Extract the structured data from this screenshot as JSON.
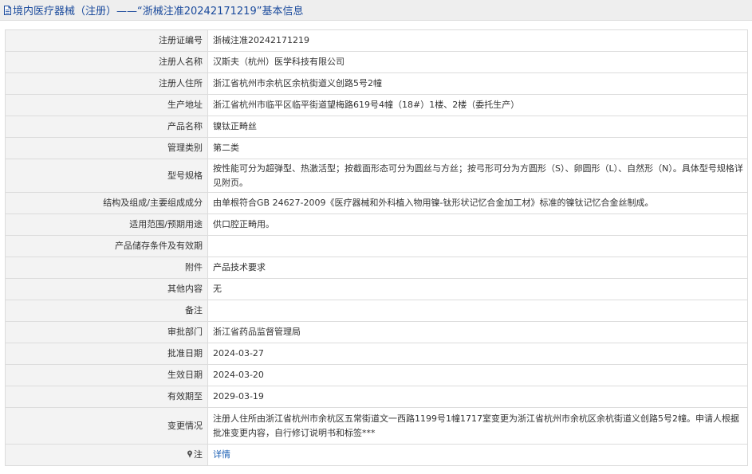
{
  "header": {
    "title": "境内医疗器械（注册）——“浙械注准20242171219”基本信息",
    "doc_icon": "document-icon",
    "title_color": "#1a4a9c"
  },
  "fields": [
    {
      "label": "注册证编号",
      "value": "浙械注准20242171219"
    },
    {
      "label": "注册人名称",
      "value": "汉斯夫（杭州）医学科技有限公司"
    },
    {
      "label": "注册人住所",
      "value": "浙江省杭州市余杭区余杭街道义创路5号2幢"
    },
    {
      "label": "生产地址",
      "value": "浙江省杭州市临平区临平街道望梅路619号4幢（18#）1楼、2楼（委托生产）"
    },
    {
      "label": "产品名称",
      "value": "镍钛正畸丝"
    },
    {
      "label": "管理类别",
      "value": "第二类"
    },
    {
      "label": "型号规格",
      "value": "按性能可分为超弹型、热激活型；按截面形态可分为圆丝与方丝；按弓形可分为方圆形（S）、卵圆形（L）、自然形（N）。具体型号规格详见附页。"
    },
    {
      "label": "结构及组成/主要组成成分",
      "value": "由单根符合GB 24627-2009《医疗器械和外科植入物用镍-钛形状记忆合金加工材》标准的镍钛记忆合金丝制成。"
    },
    {
      "label": "适用范围/预期用途",
      "value": "供口腔正畸用。"
    },
    {
      "label": "产品储存条件及有效期",
      "value": ""
    },
    {
      "label": "附件",
      "value": "产品技术要求"
    },
    {
      "label": "其他内容",
      "value": "无"
    },
    {
      "label": "备注",
      "value": ""
    },
    {
      "label": "审批部门",
      "value": "浙江省药品监督管理局"
    },
    {
      "label": "批准日期",
      "value": "2024-03-27"
    },
    {
      "label": "生效日期",
      "value": "2024-03-20"
    },
    {
      "label": "有效期至",
      "value": "2029-03-19"
    },
    {
      "label": "变更情况",
      "value": "注册人住所由浙江省杭州市余杭区五常街道文一西路1199号1幢1717室变更为浙江省杭州市余杭区余杭街道义创路5号2幢。申请人根据批准变更内容，自行修订说明书和标签***"
    }
  ],
  "note": {
    "label": "注",
    "icon": "pin-icon",
    "link_text": "详情",
    "link_color": "#1a5fb4"
  }
}
